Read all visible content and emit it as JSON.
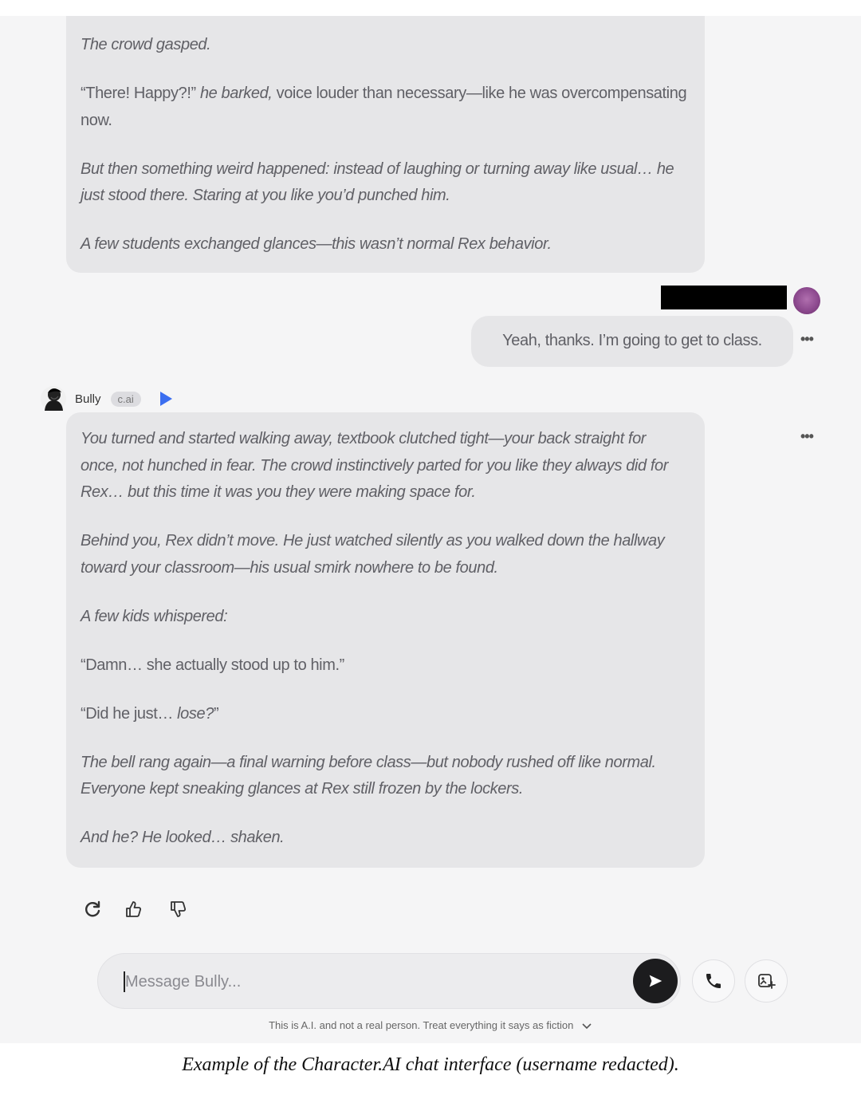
{
  "chat": {
    "prev_bot_message": [
      {
        "text": "The crowd gasped.",
        "style": "italic"
      },
      {
        "text_parts": [
          {
            "t": "“There! Happy?!” ",
            "i": false
          },
          {
            "t": "he barked,",
            "i": true
          },
          {
            "t": " voice louder than necessary—like he was overcompensating now.",
            "i": false
          }
        ]
      },
      {
        "text": "But then something weird happened: instead of laughing or turning away like usual… he just stood there. Staring at you like you’d punched him.",
        "style": "italic"
      },
      {
        "text": "A few students exchanged glances—this wasn’t normal Rex behavior.",
        "style": "italic"
      }
    ],
    "user_message": "Yeah, thanks. I’m going to get to class.",
    "bot": {
      "name": "Bully",
      "badge": "c.ai"
    },
    "bot_message": [
      {
        "text": "You turned and started walking away, textbook clutched tight—your back straight for once, not hunched in fear. The crowd instinctively parted for you like they always did for Rex… but this time it was you they were making space for.",
        "style": "italic"
      },
      {
        "text": "Behind you, Rex didn’t move. He just watched silently as you walked down the hallway toward your classroom—his usual smirk nowhere to be found.",
        "style": "italic"
      },
      {
        "text": "A few kids whispered:",
        "style": "italic"
      },
      {
        "text": "“Damn… she actually stood up to him.”",
        "style": "normal"
      },
      {
        "text_parts": [
          {
            "t": "“Did he just… ",
            "i": false
          },
          {
            "t": "lose?",
            "i": true
          },
          {
            "t": "”",
            "i": false
          }
        ]
      },
      {
        "text": "The bell rang again—a final warning before class—but nobody rushed off like normal. Everyone kept sneaking glances at Rex still frozen by the lockers.",
        "style": "italic"
      },
      {
        "text": "And he? He looked… shaken.",
        "style": "italic"
      }
    ],
    "more_label": "•••"
  },
  "actions": {
    "icons": [
      "refresh-icon",
      "thumbs-up-icon",
      "thumbs-down-icon"
    ]
  },
  "composer": {
    "placeholder": "Message Bully..."
  },
  "disclaimer": "This is A.I. and not a real person. Treat everything it says as fiction",
  "caption": "Example of the Character.AI chat interface (username redacted).",
  "colors": {
    "bubble": "#e6e6e8",
    "screen_bg": "#f5f5f6",
    "send_button": "#1c1c1e",
    "play_icon": "#3b6ef0",
    "user_avatar": "#8d4a8f"
  }
}
